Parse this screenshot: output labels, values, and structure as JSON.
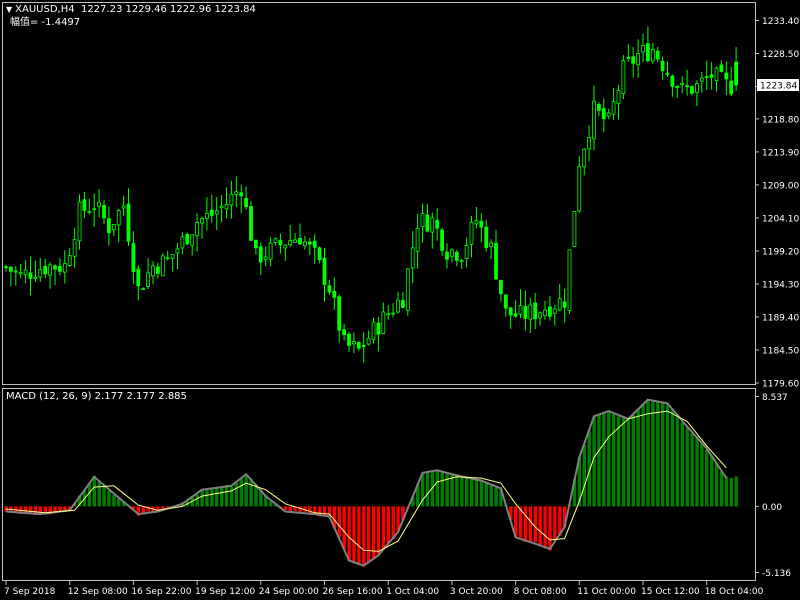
{
  "header": {
    "symbol_line": "XAUUSD,H4  1227.23 1229.46 1222.96 1223.84",
    "sub_line": "幅值= -1.4497"
  },
  "macd_panel": {
    "label": "MACD (12, 26, 9) 2.177 2.177 2.885"
  },
  "colors": {
    "background": "#000000",
    "candle": "#00ff00",
    "histogram_positive": "#008000",
    "histogram_negative": "#ff0000",
    "macd_line": "#808080",
    "signal_line": "#ffff88",
    "grid_border": "#c0c0c0",
    "text": "#ffffff"
  },
  "chart_data": [
    {
      "type": "candlestick",
      "symbol": "XAUUSD",
      "timeframe": "H4",
      "ohlc_last": {
        "open": 1227.23,
        "high": 1229.46,
        "low": 1222.96,
        "close": 1223.84
      },
      "current_price_label": "1223.84",
      "ylim": [
        1179.6,
        1236.0
      ],
      "y_ticks": [
        "1233.40",
        "1228.50",
        "1223.60",
        "1218.80",
        "1213.90",
        "1209.00",
        "1204.10",
        "1199.20",
        "1194.30",
        "1189.40",
        "1184.50",
        "1179.60"
      ],
      "y_tick_values": [
        1233.4,
        1228.5,
        1223.6,
        1218.8,
        1213.9,
        1209.0,
        1204.1,
        1199.2,
        1194.3,
        1189.4,
        1184.5,
        1179.6
      ],
      "close_path": [
        [
          0,
          1196.8
        ],
        [
          3,
          1195.5
        ],
        [
          6,
          1196.5
        ],
        [
          9,
          1197.0
        ],
        [
          12,
          1197.0
        ],
        [
          15,
          1205.0
        ],
        [
          18,
          1206.2
        ],
        [
          21,
          1202.8
        ],
        [
          24,
          1206.0
        ],
        [
          27,
          1193.5
        ],
        [
          30,
          1197.0
        ],
        [
          33,
          1197.8
        ],
        [
          36,
          1200.6
        ],
        [
          39,
          1203.6
        ],
        [
          42,
          1204.6
        ],
        [
          45,
          1206.3
        ],
        [
          48,
          1208.8
        ],
        [
          51,
          1198.2
        ],
        [
          54,
          1199.3
        ],
        [
          57,
          1200.6
        ],
        [
          60,
          1201.4
        ],
        [
          63,
          1198.5
        ],
        [
          66,
          1193.8
        ],
        [
          69,
          1185.3
        ],
        [
          72,
          1184.4
        ],
        [
          75,
          1187.4
        ],
        [
          78,
          1190.0
        ],
        [
          81,
          1192.4
        ],
        [
          84,
          1203.6
        ],
        [
          87,
          1203.7
        ],
        [
          90,
          1199.4
        ],
        [
          93,
          1199.0
        ],
        [
          96,
          1203.8
        ],
        [
          99,
          1199.5
        ],
        [
          102,
          1190.0
        ],
        [
          105,
          1189.6
        ],
        [
          108,
          1190.2
        ],
        [
          111,
          1191.1
        ],
        [
          114,
          1192.0
        ],
        [
          117,
          1212.6
        ],
        [
          120,
          1220.0
        ],
        [
          123,
          1218.2
        ],
        [
          126,
          1226.0
        ],
        [
          129,
          1228.3
        ],
        [
          132,
          1229.2
        ],
        [
          135,
          1226.0
        ],
        [
          138,
          1223.0
        ],
        [
          141,
          1223.6
        ],
        [
          144,
          1225.3
        ],
        [
          147,
          1223.8
        ]
      ],
      "bar_count": 150
    },
    {
      "type": "macd",
      "params": [
        12,
        26,
        9
      ],
      "values": {
        "macd": 2.177,
        "signal": 2.177,
        "histogram": 2.885
      },
      "ylim": [
        -5.136,
        8.537
      ],
      "y_ticks": [
        "8.537",
        "0.00",
        "-5.136"
      ],
      "y_tick_values": [
        8.537,
        0.0,
        -5.136
      ],
      "macd_path": [
        [
          0,
          -0.4
        ],
        [
          7,
          -0.6
        ],
        [
          13,
          -0.3
        ],
        [
          18,
          2.3
        ],
        [
          22,
          1.0
        ],
        [
          27,
          -0.6
        ],
        [
          31,
          -0.4
        ],
        [
          36,
          0.2
        ],
        [
          40,
          1.3
        ],
        [
          46,
          1.6
        ],
        [
          49,
          2.5
        ],
        [
          53,
          0.8
        ],
        [
          57,
          -0.4
        ],
        [
          63,
          -0.6
        ],
        [
          66,
          -0.8
        ],
        [
          70,
          -4.2
        ],
        [
          73,
          -4.6
        ],
        [
          76,
          -3.8
        ],
        [
          80,
          -2.0
        ],
        [
          85,
          2.6
        ],
        [
          88,
          2.8
        ],
        [
          92,
          2.4
        ],
        [
          97,
          2.0
        ],
        [
          101,
          1.4
        ],
        [
          104,
          -2.4
        ],
        [
          108,
          -2.9
        ],
        [
          111,
          -3.3
        ],
        [
          114,
          -1.6
        ],
        [
          117,
          3.8
        ],
        [
          120,
          7.0
        ],
        [
          123,
          7.4
        ],
        [
          127,
          6.8
        ],
        [
          131,
          8.3
        ],
        [
          135,
          8.0
        ],
        [
          139,
          6.2
        ],
        [
          143,
          4.5
        ],
        [
          147,
          2.2
        ]
      ],
      "signal_path": [
        [
          0,
          -0.2
        ],
        [
          8,
          -0.5
        ],
        [
          14,
          -0.3
        ],
        [
          18,
          1.5
        ],
        [
          22,
          1.6
        ],
        [
          27,
          0.1
        ],
        [
          31,
          -0.3
        ],
        [
          36,
          0.0
        ],
        [
          40,
          0.8
        ],
        [
          46,
          1.2
        ],
        [
          49,
          1.8
        ],
        [
          53,
          1.3
        ],
        [
          57,
          0.2
        ],
        [
          63,
          -0.5
        ],
        [
          66,
          -0.6
        ],
        [
          70,
          -2.4
        ],
        [
          73,
          -3.4
        ],
        [
          76,
          -3.5
        ],
        [
          80,
          -2.7
        ],
        [
          85,
          0.5
        ],
        [
          88,
          1.9
        ],
        [
          92,
          2.3
        ],
        [
          97,
          2.2
        ],
        [
          101,
          1.8
        ],
        [
          104,
          0.2
        ],
        [
          108,
          -1.6
        ],
        [
          111,
          -2.6
        ],
        [
          114,
          -2.5
        ],
        [
          117,
          0.4
        ],
        [
          120,
          3.8
        ],
        [
          123,
          5.4
        ],
        [
          127,
          6.8
        ],
        [
          131,
          7.2
        ],
        [
          135,
          7.4
        ],
        [
          139,
          6.6
        ],
        [
          143,
          4.7
        ],
        [
          147,
          3.0
        ]
      ]
    }
  ],
  "x_axis": {
    "labels": [
      "7 Sep 2018",
      "12 Sep 08:00",
      "16 Sep 22:00",
      "19 Sep 12:00",
      "24 Sep 00:00",
      "26 Sep 16:00",
      "1 Oct 04:00",
      "3 Oct 20:00",
      "8 Oct 08:00",
      "11 Oct 00:00",
      "15 Oct 12:00",
      "18 Oct 04:00"
    ],
    "label_bar_index": [
      0,
      13,
      26,
      39,
      52,
      65,
      78,
      91,
      104,
      117,
      130,
      143
    ]
  }
}
